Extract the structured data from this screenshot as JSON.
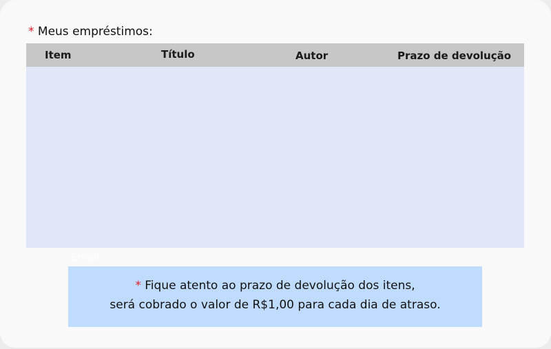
{
  "section": {
    "required_mark": "*",
    "title": "Meus empréstimos:"
  },
  "table": {
    "columns": [
      "Item",
      "Título",
      "Autor",
      "Prazo de devolução"
    ],
    "rows": []
  },
  "ghost_label": "Email",
  "notice": {
    "required_mark": "*",
    "line1": "Fique atento ao prazo de devolução dos itens,",
    "line2": "será cobrado o valor de R$1,00 para cada dia de atraso."
  },
  "colors": {
    "required": "#e2202a",
    "header_bg": "#c7c7c7",
    "body_bg": "#e1e7f7",
    "notice_bg": "#bfdcff"
  }
}
